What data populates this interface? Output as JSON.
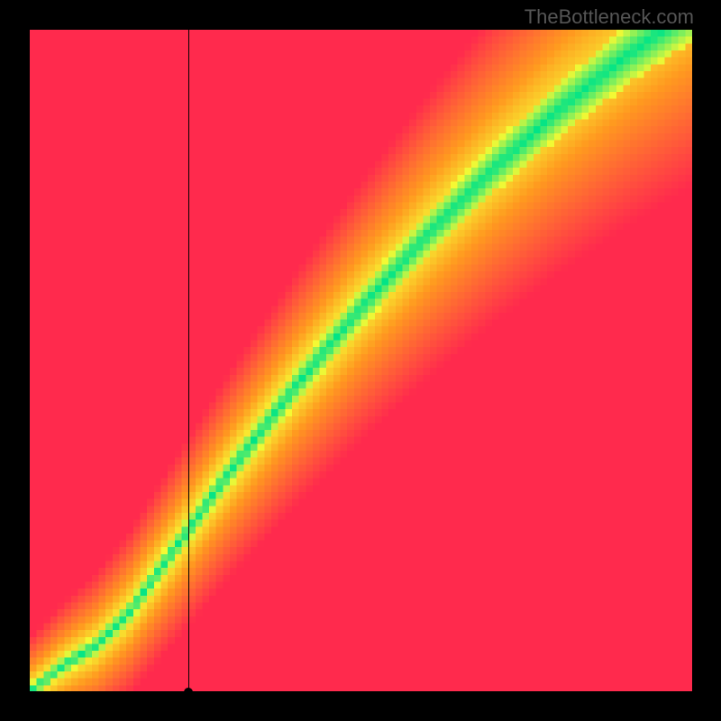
{
  "watermark": "TheBottleneck.com",
  "chart_data": {
    "type": "heatmap",
    "title": "",
    "xlabel": "",
    "ylabel": "",
    "xlim": [
      0,
      100
    ],
    "ylim": [
      0,
      100
    ],
    "grid_size": 96,
    "description": "Bottleneck heatmap. Green cells (value 0) indicate balanced pairing along a curved diagonal ridge from bottom-left toward top-right. Values rise toward 1 (red) off the ridge.",
    "colorscale": [
      {
        "value": 0.0,
        "color": "#00e487"
      },
      {
        "value": 0.12,
        "color": "#f6f933"
      },
      {
        "value": 0.45,
        "color": "#ff9a1f"
      },
      {
        "value": 1.0,
        "color": "#ff2a4d"
      }
    ],
    "ridge_samples": [
      {
        "x": 0,
        "y": 0
      },
      {
        "x": 5,
        "y": 4
      },
      {
        "x": 10,
        "y": 7
      },
      {
        "x": 15,
        "y": 12
      },
      {
        "x": 20,
        "y": 19
      },
      {
        "x": 30,
        "y": 33
      },
      {
        "x": 40,
        "y": 46
      },
      {
        "x": 50,
        "y": 58
      },
      {
        "x": 60,
        "y": 69
      },
      {
        "x": 70,
        "y": 79
      },
      {
        "x": 80,
        "y": 88
      },
      {
        "x": 90,
        "y": 96
      },
      {
        "x": 100,
        "y": 103
      }
    ],
    "crosshair": {
      "x": 24,
      "y": 0
    },
    "marker": {
      "x": 24,
      "y": 0
    }
  }
}
